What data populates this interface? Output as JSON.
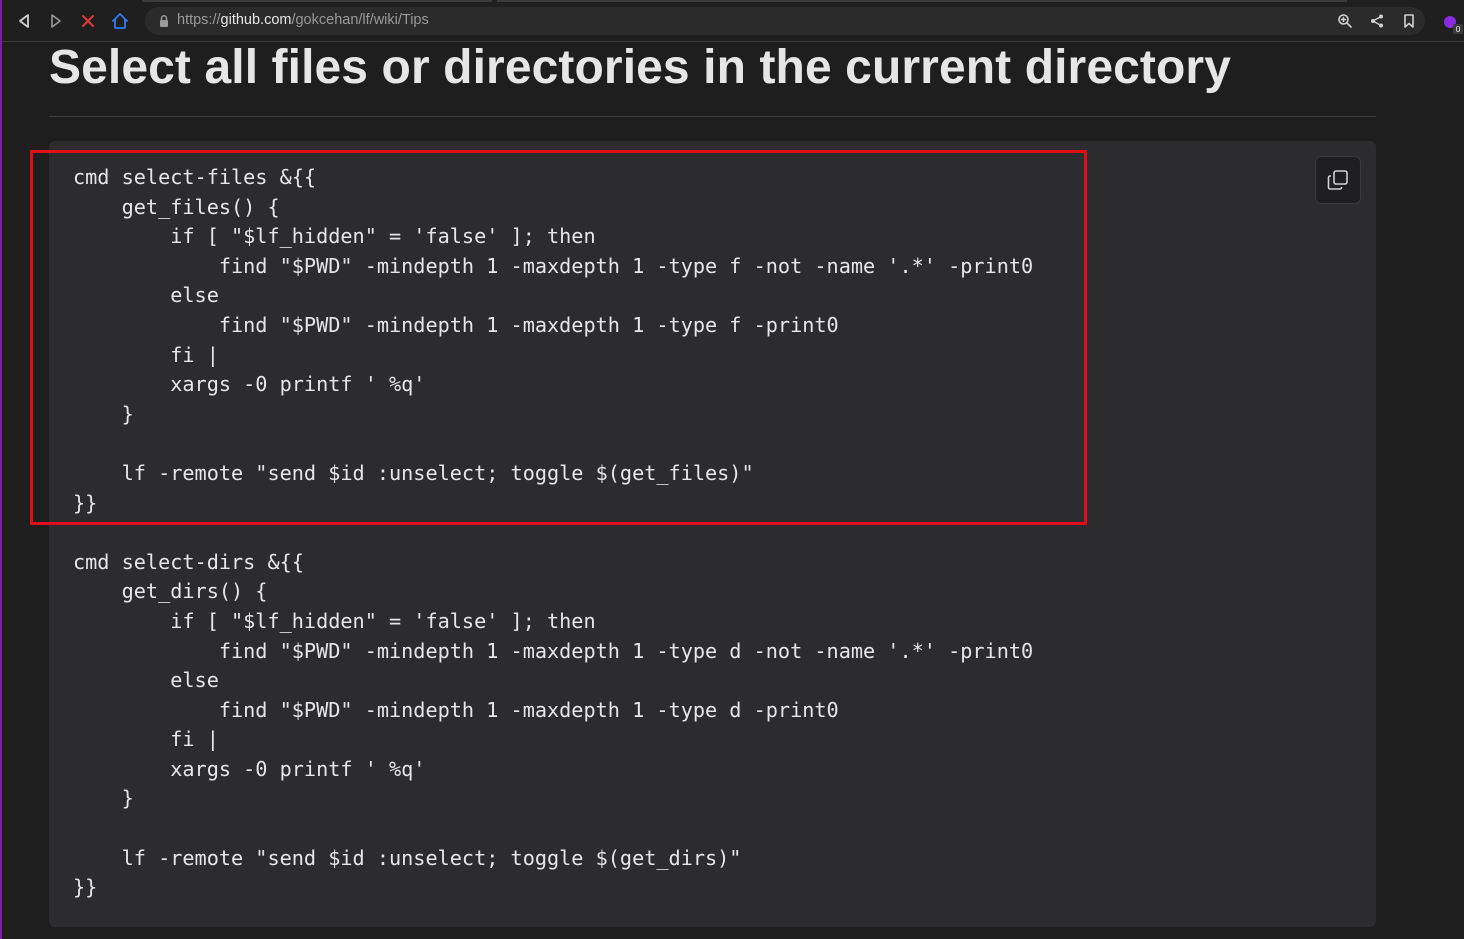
{
  "browser": {
    "url_prefix": "https://",
    "url_host": "github.com",
    "url_path": "/gokcehan/lf/wiki/Tips",
    "icons": {
      "back": "back-icon",
      "forward": "forward-icon",
      "stop": "stop-icon",
      "home": "home-icon",
      "lock": "lock-icon",
      "zoom": "zoom-icon",
      "share": "share-icon",
      "bookmark": "bookmark-icon",
      "extension": "extension-icon"
    },
    "extension_badge": "0"
  },
  "page": {
    "title": "Select all files or directories in the current directory"
  },
  "code_block": {
    "lines": [
      "cmd select-files &{{",
      "    get_files() {",
      "        if [ \"$lf_hidden\" = 'false' ]; then",
      "            find \"$PWD\" -mindepth 1 -maxdepth 1 -type f -not -name '.*' -print0",
      "        else",
      "            find \"$PWD\" -mindepth 1 -maxdepth 1 -type f -print0",
      "        fi |",
      "        xargs -0 printf ' %q'",
      "    }",
      "",
      "    lf -remote \"send $id :unselect; toggle $(get_files)\"",
      "}}",
      "",
      "cmd select-dirs &{{",
      "    get_dirs() {",
      "        if [ \"$lf_hidden\" = 'false' ]; then",
      "            find \"$PWD\" -mindepth 1 -maxdepth 1 -type d -not -name '.*' -print0",
      "        else",
      "            find \"$PWD\" -mindepth 1 -maxdepth 1 -type d -print0",
      "        fi |",
      "        xargs -0 printf ' %q'",
      "    }",
      "",
      "    lf -remote \"send $id :unselect; toggle $(get_dirs)\"",
      "}}"
    ],
    "copy_icon": "copy-icon"
  },
  "colors": {
    "highlight": "#e00d1a",
    "background": "#1e1e1e",
    "code_background": "#2c2c2e",
    "text": "#e6e6e6",
    "stop": "#e0393e",
    "home": "#2f7cf6"
  }
}
